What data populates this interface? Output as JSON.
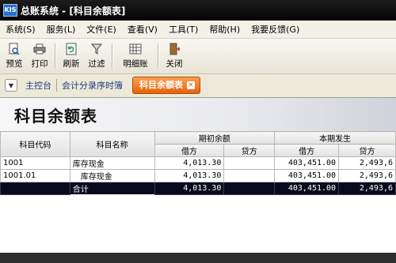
{
  "window": {
    "title": "总账系统 - [科目余额表]",
    "logo": "KIS"
  },
  "menu": [
    "系统(S)",
    "服务(L)",
    "文件(E)",
    "查看(V)",
    "工具(T)",
    "帮助(H)",
    "我要反馈(G)"
  ],
  "toolbar": {
    "preview": "预览",
    "print": "打印",
    "refresh": "刷新",
    "filter": "过滤",
    "detail": "明细账",
    "close": "关闭"
  },
  "tabs": {
    "console": "主控台",
    "journal": "会计分录序时簿",
    "active": "科目余额表"
  },
  "report": {
    "title": "科目余额表",
    "headers": {
      "code": "科目代码",
      "name": "科目名称",
      "opening": "期初余额",
      "period": "本期发生",
      "debit": "借方",
      "credit": "贷方"
    },
    "rows": [
      {
        "code": "1001",
        "name": "库存现金",
        "open_debit": "4,013.30",
        "open_credit": "",
        "per_debit": "403,451.00",
        "per_credit": "2,493,6"
      },
      {
        "code": "1001.01",
        "name": "　库存现金",
        "open_debit": "4,013.30",
        "open_credit": "",
        "per_debit": "403,451.00",
        "per_credit": "2,493,6"
      }
    ],
    "total": {
      "name": "合计",
      "open_debit": "4,013.30",
      "open_credit": "",
      "per_debit": "403,451.00",
      "per_credit": "2,493,6"
    }
  }
}
